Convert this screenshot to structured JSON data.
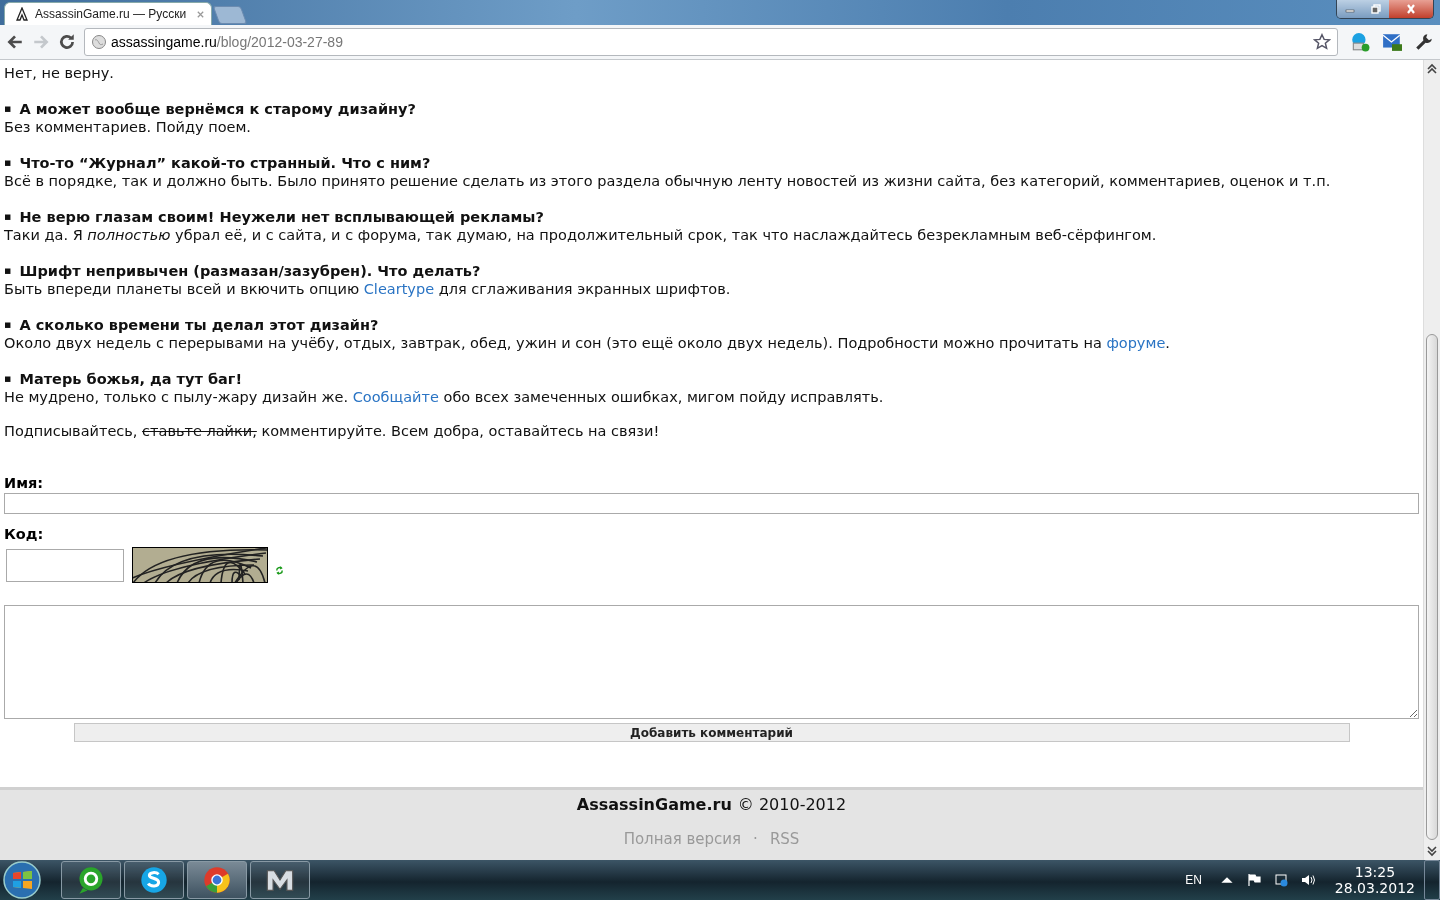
{
  "browser": {
    "tabs": [
      {
        "title": "AssassinGame.ru — Русски",
        "selected": true
      }
    ],
    "nav": {
      "back_disabled": false,
      "forward_disabled": true
    },
    "address": {
      "host": "assassingame.ru",
      "path": "/blog/2012-03-27-89"
    }
  },
  "article": {
    "lead": "Нет, не верну.",
    "faq": [
      {
        "marker": "▪",
        "question": "А может вообще вернёмся к старому дизайну?",
        "answer": [
          {
            "kind": "text",
            "text": "Без комментариев. Пойду поем."
          }
        ]
      },
      {
        "marker": "▪",
        "question": "Что-то “Журнал” какой-то странный. Что с ним?",
        "answer": [
          {
            "kind": "text",
            "text": "Всё в порядке, так и должно быть. Было принято решение сделать из этого раздела обычную ленту новостей из жизни сайта, без категорий, комментариев, оценок и т.п."
          }
        ]
      },
      {
        "marker": "▪",
        "question": "Не верю глазам своим! Неужели нет всплывающей рекламы?",
        "answer": [
          {
            "kind": "text",
            "text": "Таки да. Я *полностью* убрал её, и с сайта, и с форума, так думаю, на продолжительный срок, так что наслаждайтесь безрекламным веб-сёрфингом."
          }
        ]
      },
      {
        "marker": "▪",
        "question": "Шрифт непривычен (размазан/зазубрен). Что делать?",
        "answer": [
          {
            "kind": "text",
            "text": "Быть впереди планеты всей и вкючить опцию "
          },
          {
            "kind": "link",
            "text": "Cleartype"
          },
          {
            "kind": "text",
            "text": " для сглаживания экранных шрифтов."
          }
        ]
      },
      {
        "marker": "▪",
        "question": "А сколько времени ты делал этот дизайн?",
        "answer": [
          {
            "kind": "text",
            "text": "Около двух недель с перерывами на учёбу, отдых, завтрак, обед, ужин и сон (это ещё около двух недель). Подробности можно прочитать на "
          },
          {
            "kind": "link",
            "text": "форуме"
          },
          {
            "kind": "text",
            "text": "."
          }
        ]
      },
      {
        "marker": "▪",
        "question": "Матерь божья, да тут баг!",
        "answer": [
          {
            "kind": "text",
            "text": "Не мудрено, только с пылу-жару дизайн же. "
          },
          {
            "kind": "link",
            "text": "Сообщайте"
          },
          {
            "kind": "text",
            "text": " обо всех замеченных ошибках, мигом пойду исправлять."
          }
        ]
      }
    ],
    "closing": [
      {
        "kind": "text",
        "text": "Подписывайтесь, "
      },
      {
        "kind": "strike",
        "text": "ставьте лайки,"
      },
      {
        "kind": "text",
        "text": " комментируйте. Всем добра, оставайтесь на связи!"
      }
    ]
  },
  "comment_form": {
    "name_label": "Имя:",
    "code_label": "Код:",
    "submit": "Добавить комментарий"
  },
  "footer": {
    "site": "AssassinGame.ru",
    "copyright": "© 2010-2012",
    "links": [
      "Полная версия",
      "RSS"
    ],
    "separator": "·"
  },
  "taskbar": {
    "apps": [
      {
        "kind": "agent",
        "selected": false
      },
      {
        "kind": "skype",
        "selected": false
      },
      {
        "kind": "chrome",
        "selected": true
      },
      {
        "kind": "m",
        "selected": false
      }
    ],
    "language": "EN",
    "time": "13:25",
    "date": "28.03.2012"
  }
}
